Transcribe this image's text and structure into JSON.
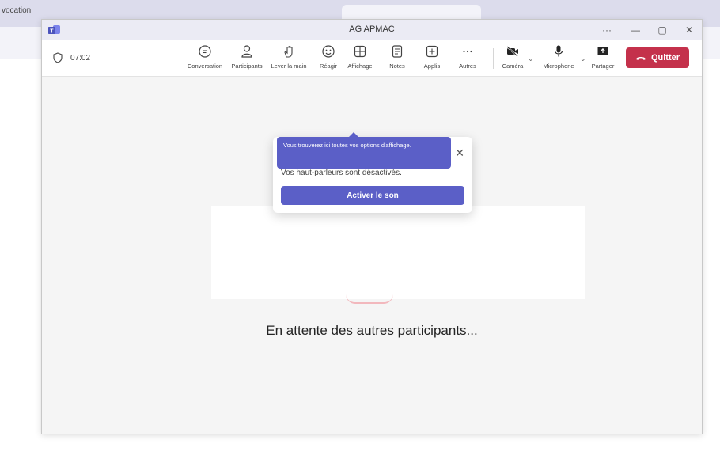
{
  "background": {
    "tab_text": "vocation"
  },
  "window": {
    "title": "AG APMAC",
    "controls": {
      "more": "···",
      "minimize": "—",
      "maximize": "▢",
      "close": "✕"
    }
  },
  "toolbar": {
    "timer": "07:02",
    "buttons": [
      {
        "label": "Conversation",
        "icon": "chat-icon"
      },
      {
        "label": "Participants",
        "icon": "people-icon"
      },
      {
        "label": "Lever la main",
        "icon": "raise-hand-icon"
      },
      {
        "label": "Réagir",
        "icon": "emoji-icon"
      },
      {
        "label": "Affichage",
        "icon": "grid-icon"
      },
      {
        "label": "Notes",
        "icon": "notes-icon"
      },
      {
        "label": "Applis",
        "icon": "plus-icon"
      },
      {
        "label": "Autres",
        "icon": "more-icon"
      },
      {
        "label": "Caméra",
        "icon": "camera-off-icon"
      },
      {
        "label": "Microphone",
        "icon": "microphone-icon"
      },
      {
        "label": "Partager",
        "icon": "share-icon"
      }
    ],
    "leave_label": "Quitter",
    "leave_color": "#c4314b"
  },
  "popup": {
    "message": "Vos haut-parleurs sont désactivés.",
    "button_label": "Activer le son",
    "accent": "#5b5fc7"
  },
  "tooltip": {
    "text": "Vous trouverez ici toutes vos options d'affichage."
  },
  "stage": {
    "waiting_text": "En attente des autres participants..."
  }
}
